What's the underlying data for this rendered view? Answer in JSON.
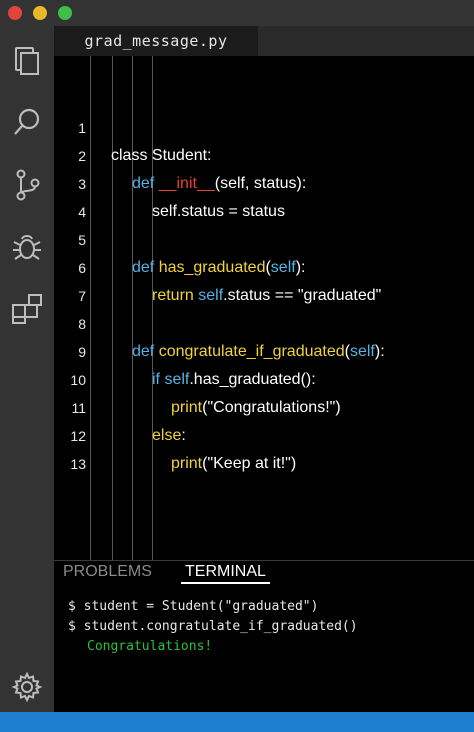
{
  "window": {
    "traffic_lights": [
      "close",
      "minimize",
      "maximize"
    ],
    "colors": {
      "close": "#e0443a",
      "minimize": "#e8b92b",
      "maximize": "#3dbf4a"
    }
  },
  "activity_bar": {
    "icons": [
      "files-icon",
      "search-icon",
      "source-control-icon",
      "debug-icon",
      "extensions-icon",
      "settings-gear-icon"
    ]
  },
  "editor": {
    "tab_title": "grad_message.py",
    "lines": [
      {
        "n": "1",
        "parts": [
          "class Student:"
        ]
      },
      {
        "n": "2",
        "parts": [
          "def",
          " ",
          "__init__",
          "(self, status):"
        ]
      },
      {
        "n": "3",
        "parts": [
          "self.status = status"
        ]
      },
      {
        "n": "4",
        "parts": [
          ""
        ]
      },
      {
        "n": "5",
        "parts": [
          "def",
          " ",
          "has_graduated",
          "(",
          "self",
          "):"
        ]
      },
      {
        "n": "6",
        "parts": [
          "return",
          " ",
          "self",
          ".status == \"graduated\""
        ]
      },
      {
        "n": "7",
        "parts": [
          ""
        ]
      },
      {
        "n": "8",
        "parts": [
          "def",
          " ",
          "congratulate_if_graduated",
          "(",
          "self",
          "):"
        ]
      },
      {
        "n": "9",
        "parts": [
          "if",
          " ",
          "self",
          ".has_graduated():"
        ]
      },
      {
        "n": "10",
        "parts": [
          "print",
          "(\"Congratulations!\")"
        ]
      },
      {
        "n": "11",
        "parts": [
          "else",
          ":"
        ]
      },
      {
        "n": "12",
        "parts": [
          "print",
          "(\"Keep at it!\")"
        ]
      },
      {
        "n": "13",
        "parts": [
          ""
        ]
      }
    ]
  },
  "panel": {
    "tabs": {
      "problems": "PROBLEMS",
      "terminal": "TERMINAL"
    },
    "terminal_lines": [
      "$ student = Student(\"graduated\")",
      "$ student.congratulate_if_graduated()",
      "Congratulations!"
    ]
  },
  "theme": {
    "keyword": "#57b4e6",
    "function": "#f0d43a",
    "dunder": "#e3432f",
    "terminal_output": "#2fbf3c",
    "statusbar": "#1e7fd0"
  }
}
